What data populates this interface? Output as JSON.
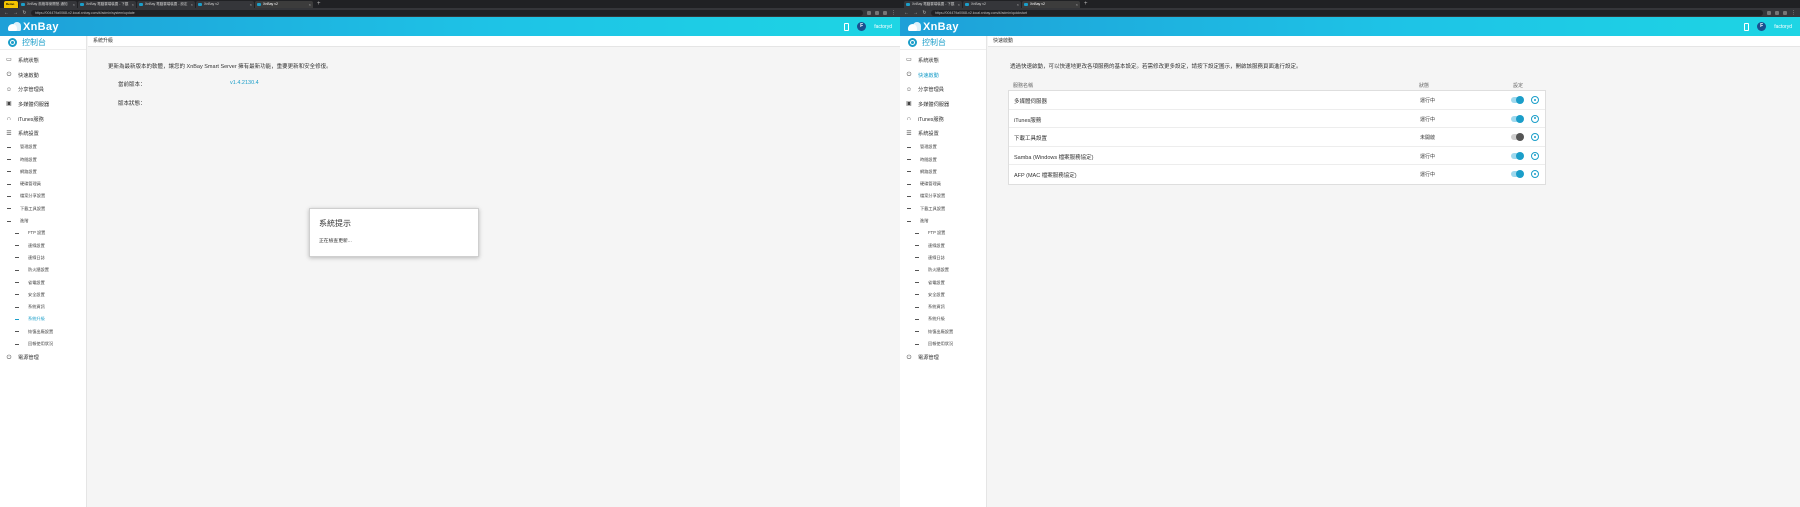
{
  "left": {
    "browser": {
      "tabs": [
        "XnBay 風格專案開發-通知",
        "XnBay 電腦雲端裝置 - 下載",
        "XnBay 電腦雲端裝置 - 設定",
        "XnBay v2",
        "XnBay v2"
      ],
      "badge": "Demo",
      "url": "https://004479a0068-v2.local.xnbay.com/#/admin/system/update"
    },
    "header": {
      "logo": "XnBay",
      "user": "factoryd",
      "avatar_letter": "F"
    },
    "sidebar": {
      "console": "控制台",
      "items": [
        "系統狀態",
        "快速啟動",
        "分享管理員",
        "多媒體伺服器",
        "iTunes服務",
        "系統設置"
      ],
      "sub": [
        "管理設置",
        "時間設置",
        "網路設置",
        "硬碟管理員",
        "檔案分享設置",
        "下載工具設置",
        "進階"
      ],
      "deep": [
        "FTP 設置",
        "連線設置",
        "連線日誌",
        "防火牆設置",
        "省電設置",
        "安全設置",
        "系統資訊",
        "系統升級",
        "恢復出廠設置",
        "回報使用狀況"
      ],
      "power": "電源管理"
    },
    "main": {
      "title": "系統升級",
      "intro": "更新為最新版本的軟體，讓您的 XnBay Smart Server 擁有最新功能，重要更新和安全修復。",
      "current_label": "當前版本：",
      "current_value": "v1.4.2130.4",
      "status_label": "版本狀態："
    },
    "dialog": {
      "title": "系統提示",
      "message": "正在檢查更新..."
    }
  },
  "right": {
    "browser": {
      "tabs": [
        "XnBay 電腦雲端裝置 - 下載",
        "XnBay v2",
        "XnBay v2"
      ],
      "url": "https://004479a0068-v2.local.xnbay.com/#/admin/quickstart"
    },
    "header": {
      "logo": "XnBay",
      "user": "factoryd",
      "avatar_letter": "F"
    },
    "sidebar": {
      "console": "控制台",
      "items": [
        "系統狀態",
        "快速啟動",
        "分享管理員",
        "多媒體伺服器",
        "iTunes服務",
        "系統設置"
      ],
      "sub": [
        "管理設置",
        "時間設置",
        "網路設置",
        "硬碟管理員",
        "檔案分享設置",
        "下載工具設置",
        "進階"
      ],
      "deep": [
        "FTP 設置",
        "連線設置",
        "連線日誌",
        "防火牆設置",
        "省電設置",
        "安全設置",
        "系統資訊",
        "系統升級",
        "恢復出廠設置",
        "回報使用狀況"
      ],
      "power": "電源管理"
    },
    "main": {
      "title": "快速啟動",
      "intro": "透過快速啟動，可以快速地更改各項服務的基本設定。若需修改更多設定，請按下設定圖示，開啟該服務頁面進行設定。",
      "columns": [
        "服務名稱",
        "狀態",
        "設定"
      ],
      "services": [
        {
          "name": "多媒體伺服器",
          "status": "運行中",
          "enabled": true
        },
        {
          "name": "iTunes服務",
          "status": "運行中",
          "enabled": true
        },
        {
          "name": "下載工具設置",
          "status": "未開啟",
          "enabled": false
        },
        {
          "name": "Samba (Windows 檔案服務協定)",
          "status": "運行中",
          "enabled": true
        },
        {
          "name": "AFP (MAC 檔案服務協定)",
          "status": "運行中",
          "enabled": true
        }
      ]
    }
  },
  "colors": {
    "accent": "#1b9ec9",
    "header_start": "#1ea0d8",
    "header_end": "#1ed5e4"
  }
}
